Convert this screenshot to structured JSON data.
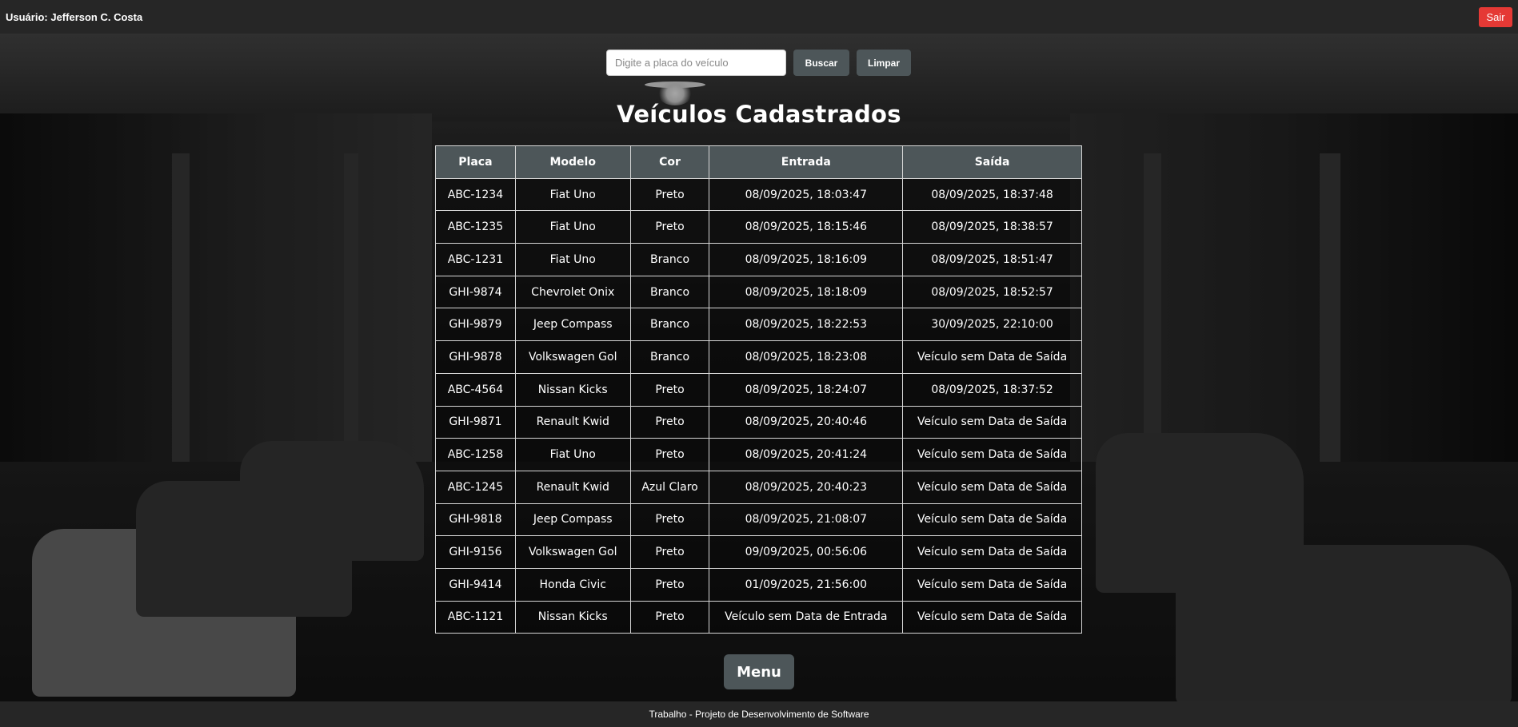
{
  "header": {
    "user_label": "Usuário: Jefferson C. Costa",
    "logout_label": "Sair"
  },
  "search": {
    "placeholder": "Digite a placa do veículo",
    "value": "",
    "search_label": "Buscar",
    "clear_label": "Limpar"
  },
  "title": "Veículos Cadastrados",
  "table": {
    "headers": [
      "Placa",
      "Modelo",
      "Cor",
      "Entrada",
      "Saída"
    ],
    "rows": [
      [
        "ABC-1234",
        "Fiat Uno",
        "Preto",
        "08/09/2025, 18:03:47",
        "08/09/2025, 18:37:48"
      ],
      [
        "ABC-1235",
        "Fiat Uno",
        "Preto",
        "08/09/2025, 18:15:46",
        "08/09/2025, 18:38:57"
      ],
      [
        "ABC-1231",
        "Fiat Uno",
        "Branco",
        "08/09/2025, 18:16:09",
        "08/09/2025, 18:51:47"
      ],
      [
        "GHI-9874",
        "Chevrolet Onix",
        "Branco",
        "08/09/2025, 18:18:09",
        "08/09/2025, 18:52:57"
      ],
      [
        "GHI-9879",
        "Jeep Compass",
        "Branco",
        "08/09/2025, 18:22:53",
        "30/09/2025, 22:10:00"
      ],
      [
        "GHI-9878",
        "Volkswagen Gol",
        "Branco",
        "08/09/2025, 18:23:08",
        "Veículo sem Data de Saída"
      ],
      [
        "ABC-4564",
        "Nissan Kicks",
        "Preto",
        "08/09/2025, 18:24:07",
        "08/09/2025, 18:37:52"
      ],
      [
        "GHI-9871",
        "Renault Kwid",
        "Preto",
        "08/09/2025, 20:40:46",
        "Veículo sem Data de Saída"
      ],
      [
        "ABC-1258",
        "Fiat Uno",
        "Preto",
        "08/09/2025, 20:41:24",
        "Veículo sem Data de Saída"
      ],
      [
        "ABC-1245",
        "Renault Kwid",
        "Azul Claro",
        "08/09/2025, 20:40:23",
        "Veículo sem Data de Saída"
      ],
      [
        "GHI-9818",
        "Jeep Compass",
        "Preto",
        "08/09/2025, 21:08:07",
        "Veículo sem Data de Saída"
      ],
      [
        "GHI-9156",
        "Volkswagen Gol",
        "Preto",
        "09/09/2025, 00:56:06",
        "Veículo sem Data de Saída"
      ],
      [
        "GHI-9414",
        "Honda Civic",
        "Preto",
        "01/09/2025, 21:56:00",
        "Veículo sem Data de Saída"
      ],
      [
        "ABC-1121",
        "Nissan Kicks",
        "Preto",
        "Veículo sem Data de Entrada",
        "Veículo sem Data de Saída"
      ]
    ]
  },
  "menu_label": "Menu",
  "footer": {
    "text": "Trabalho - Projeto de Desenvolvimento de Software"
  },
  "colors": {
    "header_bg": "#262626",
    "logout_red": "#e53935",
    "button_gray": "#4d5659",
    "table_header_bg": "#4d5659"
  }
}
